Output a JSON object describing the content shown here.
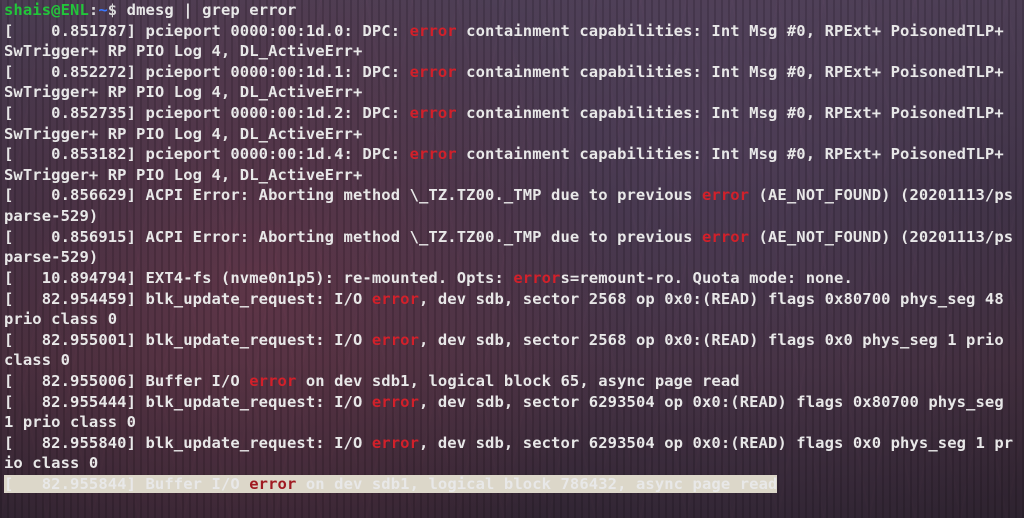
{
  "colors": {
    "user_host": "#22c53a",
    "path": "#3b78ff",
    "text": "#e8e8e8",
    "highlight": "#d2202a",
    "selection_bg": "#dcd7c9"
  },
  "prompt": {
    "user": "shais",
    "at": "@",
    "host": "ENL",
    "colon": ":",
    "path": "~",
    "dollar": "$ ",
    "command": "dmesg | grep error"
  },
  "lines": [
    {
      "segs": [
        {
          "t": "[    0.851787] pcieport 0000:00:1d.0: DPC: "
        },
        {
          "t": "error",
          "hl": true
        },
        {
          "t": " containment capabilities: Int Msg #0, RPExt+ PoisonedTLP+ SwTrigger+ RP PIO Log 4, DL_ActiveErr+"
        }
      ]
    },
    {
      "segs": [
        {
          "t": "[    0.852272] pcieport 0000:00:1d.1: DPC: "
        },
        {
          "t": "error",
          "hl": true
        },
        {
          "t": " containment capabilities: Int Msg #0, RPExt+ PoisonedTLP+ SwTrigger+ RP PIO Log 4, DL_ActiveErr+"
        }
      ]
    },
    {
      "segs": [
        {
          "t": "[    0.852735] pcieport 0000:00:1d.2: DPC: "
        },
        {
          "t": "error",
          "hl": true
        },
        {
          "t": " containment capabilities: Int Msg #0, RPExt+ PoisonedTLP+ SwTrigger+ RP PIO Log 4, DL_ActiveErr+"
        }
      ]
    },
    {
      "segs": [
        {
          "t": "[    0.853182] pcieport 0000:00:1d.4: DPC: "
        },
        {
          "t": "error",
          "hl": true
        },
        {
          "t": " containment capabilities: Int Msg #0, RPExt+ PoisonedTLP+ SwTrigger+ RP PIO Log 4, DL_ActiveErr+"
        }
      ]
    },
    {
      "segs": [
        {
          "t": "[    0.856629] ACPI Error: Aborting method \\_TZ.TZ00._TMP due to previous "
        },
        {
          "t": "error",
          "hl": true
        },
        {
          "t": " (AE_NOT_FOUND) (20201113/psparse-529)"
        }
      ]
    },
    {
      "segs": [
        {
          "t": "[    0.856915] ACPI Error: Aborting method \\_TZ.TZ00._TMP due to previous "
        },
        {
          "t": "error",
          "hl": true
        },
        {
          "t": " (AE_NOT_FOUND) (20201113/psparse-529)"
        }
      ]
    },
    {
      "segs": [
        {
          "t": "[   10.894794] EXT4-fs (nvme0n1p5): re-mounted. Opts: "
        },
        {
          "t": "error",
          "hl": true
        },
        {
          "t": "s=remount-ro. Quota mode: none."
        }
      ]
    },
    {
      "segs": [
        {
          "t": "[   82.954459] blk_update_request: I/O "
        },
        {
          "t": "error",
          "hl": true
        },
        {
          "t": ", dev sdb, sector 2568 op 0x0:(READ) flags 0x80700 phys_seg 48 prio class 0"
        }
      ]
    },
    {
      "segs": [
        {
          "t": "[   82.955001] blk_update_request: I/O "
        },
        {
          "t": "error",
          "hl": true
        },
        {
          "t": ", dev sdb, sector 2568 op 0x0:(READ) flags 0x0 phys_seg 1 prio class 0"
        }
      ]
    },
    {
      "segs": [
        {
          "t": "[   82.955006] Buffer I/O "
        },
        {
          "t": "error",
          "hl": true
        },
        {
          "t": " on dev sdb1, logical block 65, async page read"
        }
      ]
    },
    {
      "segs": [
        {
          "t": "[   82.955444] blk_update_request: I/O "
        },
        {
          "t": "error",
          "hl": true
        },
        {
          "t": ", dev sdb, sector 6293504 op 0x0:(READ) flags 0x80700 phys_seg 1 prio class 0"
        }
      ]
    },
    {
      "segs": [
        {
          "t": "[   82.955840] blk_update_request: I/O "
        },
        {
          "t": "error",
          "hl": true
        },
        {
          "t": ", dev sdb, sector 6293504 op 0x0:(READ) flags 0x0 phys_seg 1 prio class 0"
        }
      ]
    },
    {
      "selected": true,
      "segs": [
        {
          "t": "[   82.955844] Buffer I/O "
        },
        {
          "t": "error",
          "hl": true
        },
        {
          "t": " on dev sdb1, logical block 786432, async page read"
        }
      ]
    }
  ]
}
